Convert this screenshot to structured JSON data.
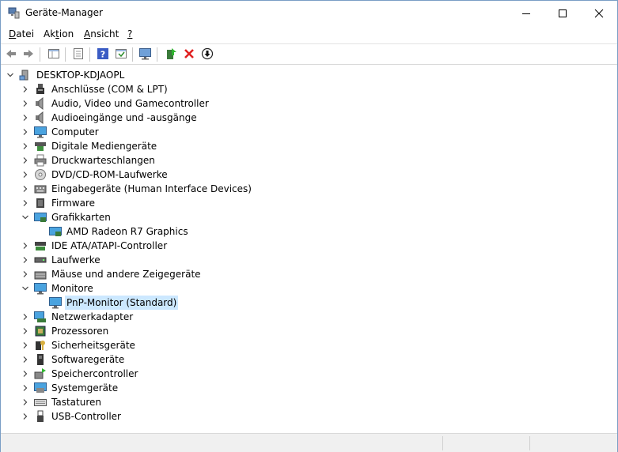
{
  "window": {
    "title": "Geräte-Manager"
  },
  "menu": [
    {
      "pre": "",
      "ul": "D",
      "post": "atei"
    },
    {
      "pre": "Ak",
      "ul": "t",
      "post": "ion"
    },
    {
      "pre": "",
      "ul": "A",
      "post": "nsicht"
    },
    {
      "pre": "",
      "ul": "?",
      "post": ""
    }
  ],
  "tree": {
    "root": "DESKTOP-KDJAOPL",
    "items": [
      {
        "label": "Anschlüsse (COM & LPT)",
        "icon": "port-icon"
      },
      {
        "label": "Audio, Video und Gamecontroller",
        "icon": "speaker-icon"
      },
      {
        "label": "Audioeingänge und -ausgänge",
        "icon": "speaker-icon"
      },
      {
        "label": "Computer",
        "icon": "monitor-icon"
      },
      {
        "label": "Digitale Mediengeräte",
        "icon": "media-device-icon"
      },
      {
        "label": "Druckwarteschlangen",
        "icon": "printer-icon"
      },
      {
        "label": "DVD/CD-ROM-Laufwerke",
        "icon": "dvd-icon"
      },
      {
        "label": "Eingabegeräte (Human Interface Devices)",
        "icon": "hid-icon"
      },
      {
        "label": "Firmware",
        "icon": "chip-icon"
      },
      {
        "label": "Grafikkarten",
        "icon": "display-adapter-icon",
        "expanded": true,
        "children": [
          {
            "label": "AMD Radeon R7 Graphics",
            "icon": "display-adapter-icon"
          }
        ]
      },
      {
        "label": "IDE ATA/ATAPI-Controller",
        "icon": "ide-controller-icon"
      },
      {
        "label": "Laufwerke",
        "icon": "disk-drive-icon"
      },
      {
        "label": "Mäuse und andere Zeigegeräte",
        "icon": "mouse-icon"
      },
      {
        "label": "Monitore",
        "icon": "monitor-icon",
        "expanded": true,
        "children": [
          {
            "label": "PnP-Monitor (Standard)",
            "icon": "monitor-icon",
            "selected": true
          }
        ]
      },
      {
        "label": "Netzwerkadapter",
        "icon": "network-icon"
      },
      {
        "label": "Prozessoren",
        "icon": "processor-icon"
      },
      {
        "label": "Sicherheitsgeräte",
        "icon": "security-icon"
      },
      {
        "label": "Softwaregeräte",
        "icon": "software-device-icon"
      },
      {
        "label": "Speichercontroller",
        "icon": "storage-controller-icon"
      },
      {
        "label": "Systemgeräte",
        "icon": "system-device-icon"
      },
      {
        "label": "Tastaturen",
        "icon": "keyboard-icon"
      },
      {
        "label": "USB-Controller",
        "icon": "usb-icon"
      }
    ]
  },
  "colors": {
    "selection": "#cce8ff",
    "accent": "#2b79d9",
    "uninstall": "#e02020"
  }
}
